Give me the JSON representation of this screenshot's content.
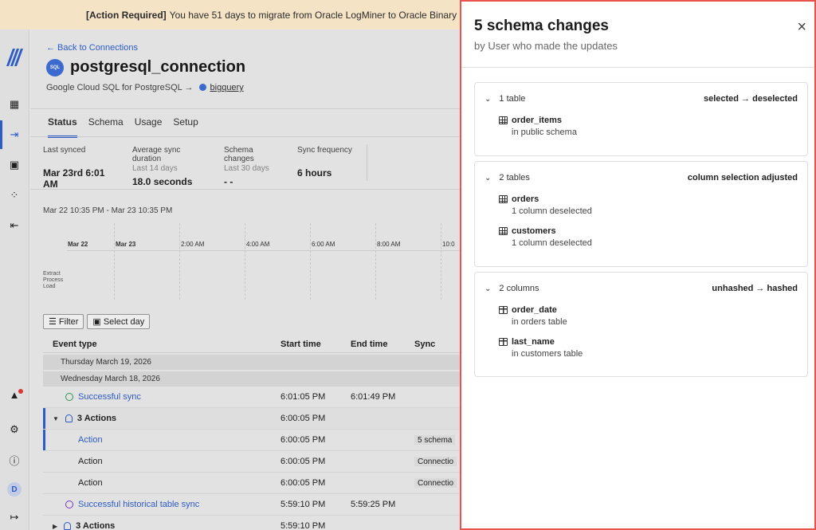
{
  "banner": {
    "bold": "[Action Required]",
    "text": "You have 51 days to migrate from Oracle LogMiner to Oracle Binary Log Re"
  },
  "rail": {
    "icons": [
      "fivetran-logo-icon",
      "dashboard-icon",
      "connections-icon",
      "transformations-icon",
      "activations-icon",
      "destinations-icon",
      "alerts-icon",
      "settings-icon",
      "info-icon",
      "user-avatar",
      "collapse-icon"
    ],
    "avatar_letter": "D"
  },
  "header": {
    "back_label": "← Back to Connections",
    "conn_icon_text": "SQL",
    "title": "postgresql_connection",
    "source": "Google Cloud SQL for PostgreSQL",
    "arrow": "→",
    "destination": "bigquery"
  },
  "tabs": [
    "Status",
    "Schema",
    "Usage",
    "Setup"
  ],
  "stats": [
    {
      "label": "Last synced",
      "sub": "",
      "value": "Mar 23rd 6:01 AM"
    },
    {
      "label": "Average sync duration",
      "sub": "Last 14 days",
      "value": "18.0 seconds"
    },
    {
      "label": "Schema changes",
      "sub": "Last 30 days",
      "value": "- -"
    },
    {
      "label": "Sync frequency",
      "sub": "",
      "value": "6 hours"
    }
  ],
  "timeline": {
    "range": "Mar 22 10:35 PM - Mar 23 10:35 PM",
    "labels": [
      "Mar 22",
      "Mar 23",
      "2:00 AM",
      "4:00 AM",
      "6:00 AM",
      "8:00 AM",
      "10:0"
    ],
    "rows": [
      "Extract",
      "Process",
      "Load"
    ]
  },
  "buttons": {
    "filter": "Filter",
    "select_day": "Select day"
  },
  "table": {
    "headers": [
      "Event type",
      "Start time",
      "End time",
      "Sync"
    ],
    "date1": "Thursday March 19, 2026",
    "date2": "Wednesday March 18, 2026",
    "rows": [
      {
        "event": "Successful sync",
        "start": "6:01:05 PM",
        "end": "6:01:49 PM",
        "sync": ""
      },
      {
        "event": "3 Actions",
        "start": "6:00:05 PM",
        "end": "",
        "sync": ""
      },
      {
        "event": "Action",
        "start": "6:00:05 PM",
        "end": "",
        "sync": "5 schema"
      },
      {
        "event": "Action",
        "start": "6:00:05 PM",
        "end": "",
        "sync": "Connectio"
      },
      {
        "event": "Action",
        "start": "6:00:05 PM",
        "end": "",
        "sync": "Connectio"
      },
      {
        "event": "Successful historical table sync",
        "start": "5:59:10 PM",
        "end": "5:59:25 PM",
        "sync": ""
      },
      {
        "event": "3 Actions",
        "start": "5:59:10 PM",
        "end": "",
        "sync": ""
      }
    ]
  },
  "panel": {
    "title": "5 schema changes",
    "subtitle": "by User who made the updates",
    "close": "×",
    "groups": [
      {
        "count": "1 table",
        "change": "selected → deselected",
        "items": [
          {
            "name": "order_items",
            "desc": "in public schema",
            "icon": "table-icon"
          }
        ]
      },
      {
        "count": "2 tables",
        "change": "column selection adjusted",
        "items": [
          {
            "name": "orders",
            "desc": "1 column deselected",
            "icon": "table-icon"
          },
          {
            "name": "customers",
            "desc": "1 column deselected",
            "icon": "table-icon"
          }
        ]
      },
      {
        "count": "2 columns",
        "change": "unhashed → hashed",
        "items": [
          {
            "name": "order_date",
            "desc": "in orders table",
            "icon": "column-icon"
          },
          {
            "name": "last_name",
            "desc": "in customers table",
            "icon": "column-icon"
          }
        ]
      }
    ]
  },
  "colors": {
    "accent": "#2f5fd0",
    "panel_border": "#e9534b",
    "banner": "#f5e3c6"
  }
}
